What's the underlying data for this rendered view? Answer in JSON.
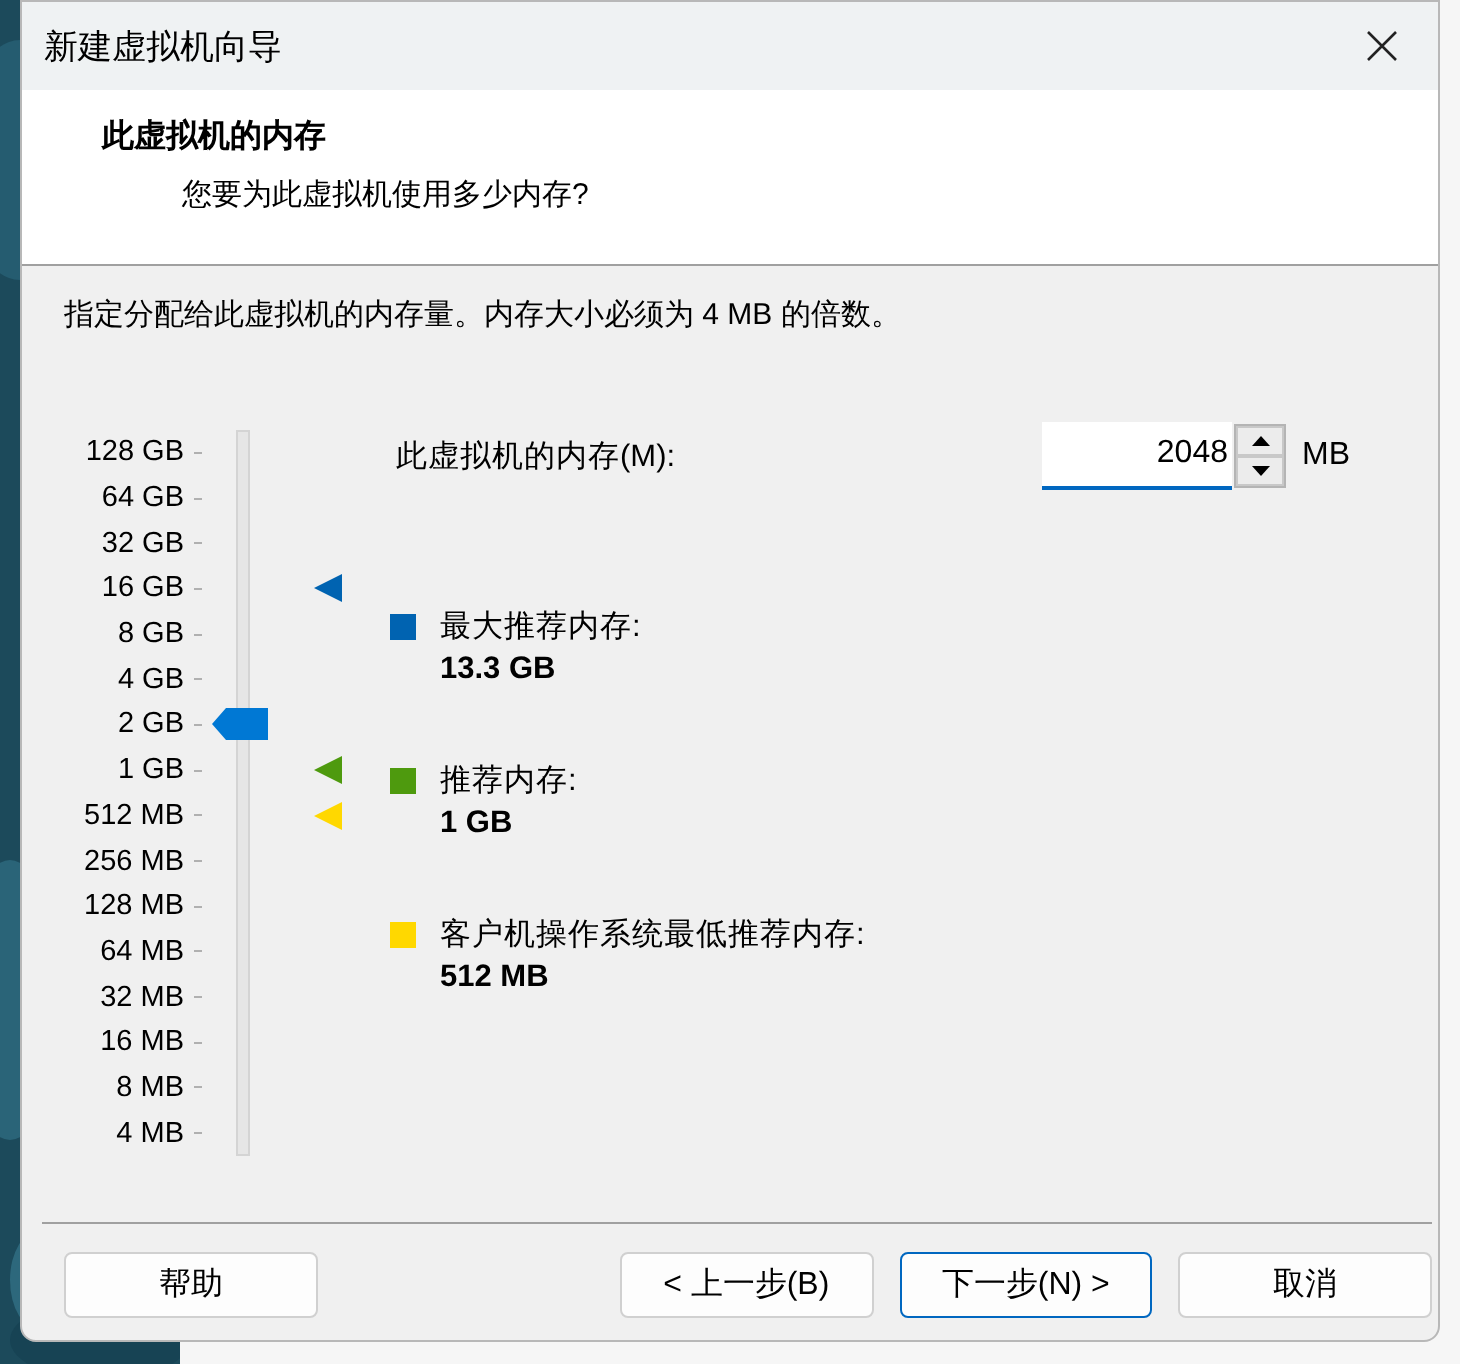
{
  "window": {
    "title": "新建虚拟机向导"
  },
  "header": {
    "title": "此虚拟机的内存",
    "subtitle": "您要为此虚拟机使用多少内存?"
  },
  "description": "指定分配给此虚拟机的内存量。内存大小必须为 4 MB 的倍数。",
  "slider": {
    "ticks": [
      {
        "label": "128 GB",
        "selected": false
      },
      {
        "label": "64 GB",
        "selected": false
      },
      {
        "label": "32 GB",
        "selected": false
      },
      {
        "label": "16 GB",
        "selected": false,
        "color": "#0063b1"
      },
      {
        "label": "8 GB",
        "selected": false
      },
      {
        "label": "4 GB",
        "selected": false
      },
      {
        "label": "2 GB",
        "selected": true
      },
      {
        "label": "1 GB",
        "selected": false,
        "color": "#4e9a0e"
      },
      {
        "label": "512 MB",
        "selected": false,
        "color": "#ffd800"
      },
      {
        "label": "256 MB",
        "selected": false
      },
      {
        "label": "128 MB",
        "selected": false
      },
      {
        "label": "64 MB",
        "selected": false
      },
      {
        "label": "32 MB",
        "selected": false
      },
      {
        "label": "16 MB",
        "selected": false
      },
      {
        "label": "8 MB",
        "selected": false
      },
      {
        "label": "4 MB",
        "selected": false
      }
    ]
  },
  "memory": {
    "label": "此虚拟机的内存(M):",
    "value": "2048",
    "unit": "MB"
  },
  "legend": [
    {
      "label": "最大推荐内存:",
      "value": "13.3 GB",
      "color": "#0063b1"
    },
    {
      "label": "推荐内存:",
      "value": "1 GB",
      "color": "#4e9a0e"
    },
    {
      "label": "客户机操作系统最低推荐内存:",
      "value": "512 MB",
      "color": "#ffd800"
    }
  ],
  "buttons": [
    {
      "label": "帮助",
      "focused": false
    },
    {
      "label": "< 上一步(B)",
      "focused": false
    },
    {
      "label": "下一步(N) >",
      "focused": true
    },
    {
      "label": "取消",
      "focused": false
    }
  ]
}
